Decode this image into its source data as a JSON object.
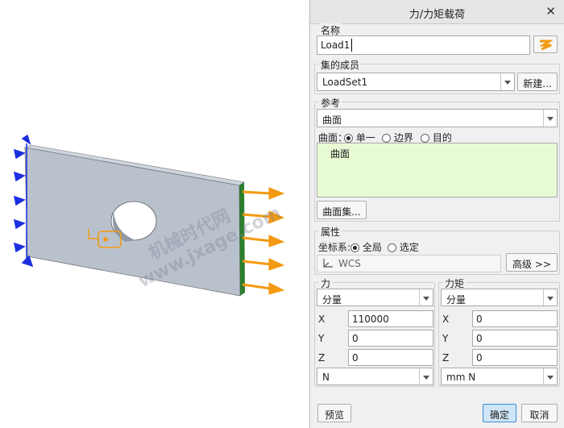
{
  "viewport": {
    "watermark_1": "机械时代网",
    "watermark_2": "www.jxage.com"
  },
  "dialog": {
    "title": "力/力矩载荷",
    "name_section": {
      "label": "名称",
      "value": "Load1"
    },
    "set_section": {
      "label": "集的成员",
      "selected": "LoadSet1",
      "new_button": "新建..."
    },
    "ref_section": {
      "label": "参考",
      "selected": "曲面",
      "surface_label": "曲面：",
      "options": [
        "单一",
        "边界",
        "目的"
      ],
      "selected_option": "单一",
      "collector_item": "曲面",
      "surface_set_button": "曲面集..."
    },
    "props_section": {
      "label": "属性",
      "coord_label": "坐标系:",
      "coord_options": [
        "全局",
        "选定"
      ],
      "coord_selected": "全局",
      "coord_value": "WCS",
      "advanced_button": "高级 >>"
    },
    "force": {
      "label": "力",
      "mode": "分量",
      "x_label": "X",
      "x_value": "110000",
      "y_label": "Y",
      "y_value": "0",
      "z_label": "Z",
      "z_value": "0",
      "unit": "N"
    },
    "moment": {
      "label": "力矩",
      "mode": "分量",
      "x_label": "X",
      "x_value": "0",
      "y_label": "Y",
      "y_value": "0",
      "z_label": "Z",
      "z_value": "0",
      "unit": "mm N"
    },
    "preview_button": "预览",
    "ok_button": "确定",
    "cancel_button": "取消"
  },
  "colors": {
    "plate": "#b9c1cd",
    "force_arrow": "#f39a12",
    "constraint": "#1c2ee0",
    "load_edge": "#2d7d2f",
    "collector_bg": "#e8fad4",
    "ok_bg": "#cfe6f8"
  }
}
